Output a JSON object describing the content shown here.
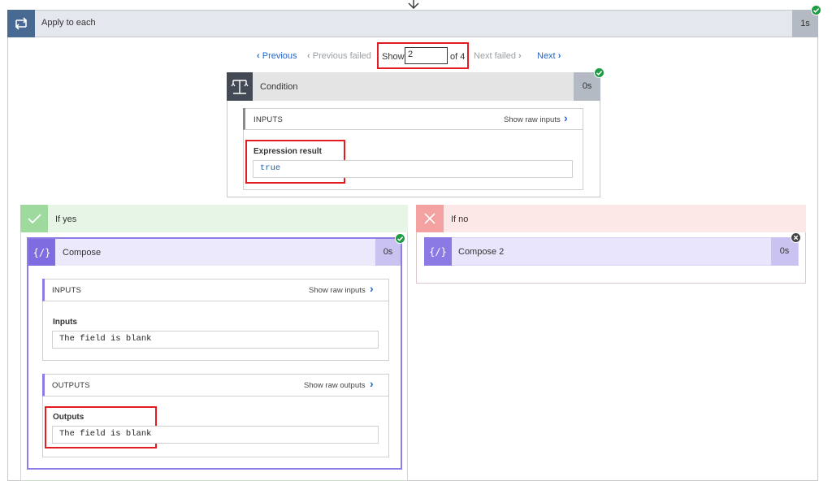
{
  "apply_to_each": {
    "title": "Apply to each",
    "duration": "1s"
  },
  "pager": {
    "previous": "Previous",
    "previous_failed": "Previous failed",
    "show_label": "Show",
    "current_iteration": "2",
    "of_total": "of 4",
    "next_failed": "Next failed",
    "next": "Next"
  },
  "condition": {
    "title": "Condition",
    "duration": "0s",
    "inputs_title": "INPUTS",
    "show_raw_inputs": "Show raw inputs",
    "expression_label": "Expression result",
    "expression_value": "true"
  },
  "if_yes": {
    "title": "If yes",
    "compose": {
      "title": "Compose",
      "duration": "0s",
      "inputs_title": "INPUTS",
      "show_raw_inputs": "Show raw inputs",
      "inputs_label": "Inputs",
      "inputs_value": "The field is blank",
      "outputs_title": "OUTPUTS",
      "show_raw_outputs": "Show raw outputs",
      "outputs_label": "Outputs",
      "outputs_value": "The field is blank"
    }
  },
  "if_no": {
    "title": "If no",
    "compose2": {
      "title": "Compose 2",
      "duration": "0s"
    }
  },
  "colors": {
    "link": "#2266cc",
    "success": "#1e9b43",
    "highlight": "#e31b23",
    "compose_accent": "#7f6ce1"
  }
}
